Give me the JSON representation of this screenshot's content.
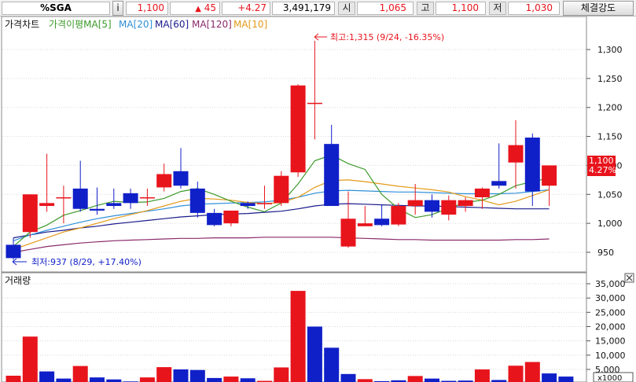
{
  "header": {
    "symbol": "%SGA",
    "info_label": "i",
    "price": "1,100",
    "change_arrow": "▲",
    "change": "45",
    "change_pct": "+4.27",
    "volume": "3,491,179",
    "open_label": "시",
    "open": "1,065",
    "high_label": "고",
    "high": "1,100",
    "low_label": "저",
    "low": "1,030",
    "strength_button": "체결강도"
  },
  "legend": {
    "title": "가격차트",
    "items": [
      {
        "label": "가격이평MA[5]",
        "color": "#3c9a2a"
      },
      {
        "label": "MA[20]",
        "color": "#2f8fd8"
      },
      {
        "label": "MA[60]",
        "color": "#1a1a8c"
      },
      {
        "label": "MA[120]",
        "color": "#8a2a6a"
      },
      {
        "label": "MA[10]",
        "color": "#e39a1a"
      }
    ]
  },
  "annotations": {
    "high": "최고:1,315 (9/24, -16.35%)",
    "low": "최저:937 (8/29, +17.40%)"
  },
  "price_axis": {
    "ticks": [
      "1,300",
      "1,250",
      "1,200",
      "1,150",
      "1,100",
      "1,050",
      "1,000",
      "950"
    ],
    "current_price": "1,100",
    "current_pct": "4.27%"
  },
  "volume_panel": {
    "title": "거래량",
    "ticks": [
      "35,000",
      "30,000",
      "25,000",
      "20,000",
      "15,000",
      "10,000",
      "5,000"
    ],
    "unit": "x1000",
    "close_icon": "close-icon"
  },
  "colors": {
    "up": "#e8141c",
    "down": "#1020c8",
    "ma5": "#3c9a2a",
    "ma20": "#2f8fd8",
    "ma60": "#1a1a8c",
    "ma120": "#8a2a6a",
    "ma10": "#e39a1a"
  },
  "chart_data": [
    {
      "type": "candlestick",
      "title": "가격차트",
      "ylim": [
        910,
        1345
      ],
      "candles": [
        {
          "open": 963,
          "high": 975,
          "low": 937,
          "close": 940
        },
        {
          "open": 985,
          "high": 1050,
          "low": 975,
          "close": 1050
        },
        {
          "open": 1030,
          "high": 1120,
          "low": 1020,
          "close": 1035
        },
        {
          "open": 1045,
          "high": 1065,
          "low": 1000,
          "close": 1045
        },
        {
          "open": 1060,
          "high": 1108,
          "low": 1020,
          "close": 1025
        },
        {
          "open": 1025,
          "high": 1062,
          "low": 1015,
          "close": 1022
        },
        {
          "open": 1035,
          "high": 1060,
          "low": 1025,
          "close": 1030
        },
        {
          "open": 1052,
          "high": 1060,
          "low": 1025,
          "close": 1035
        },
        {
          "open": 1045,
          "high": 1060,
          "low": 1030,
          "close": 1045
        },
        {
          "open": 1062,
          "high": 1103,
          "low": 1055,
          "close": 1085
        },
        {
          "open": 1090,
          "high": 1130,
          "low": 1060,
          "close": 1065
        },
        {
          "open": 1060,
          "high": 1072,
          "low": 1010,
          "close": 1018
        },
        {
          "open": 1018,
          "high": 1025,
          "low": 995,
          "close": 997
        },
        {
          "open": 1000,
          "high": 1020,
          "low": 995,
          "close": 1022
        },
        {
          "open": 1035,
          "high": 1038,
          "low": 1025,
          "close": 1030
        },
        {
          "open": 1035,
          "high": 1065,
          "low": 1025,
          "close": 1035
        },
        {
          "open": 1035,
          "high": 1090,
          "low": 1030,
          "close": 1082
        },
        {
          "open": 1088,
          "high": 1240,
          "low": 1080,
          "close": 1238
        },
        {
          "open": 1208,
          "high": 1315,
          "low": 1145,
          "close": 1208
        },
        {
          "open": 1137,
          "high": 1170,
          "low": 1030,
          "close": 1030
        },
        {
          "open": 960,
          "high": 1055,
          "low": 958,
          "close": 1008
        },
        {
          "open": 995,
          "high": 1030,
          "low": 995,
          "close": 1000
        },
        {
          "open": 1008,
          "high": 1032,
          "low": 995,
          "close": 997
        },
        {
          "open": 998,
          "high": 1035,
          "low": 995,
          "close": 1030
        },
        {
          "open": 1030,
          "high": 1068,
          "low": 1015,
          "close": 1040
        },
        {
          "open": 1040,
          "high": 1050,
          "low": 1010,
          "close": 1020
        },
        {
          "open": 1015,
          "high": 1048,
          "low": 1005,
          "close": 1040
        },
        {
          "open": 1030,
          "high": 1045,
          "low": 1020,
          "close": 1040
        },
        {
          "open": 1045,
          "high": 1062,
          "low": 1025,
          "close": 1060
        },
        {
          "open": 1073,
          "high": 1138,
          "low": 1060,
          "close": 1065
        },
        {
          "open": 1105,
          "high": 1178,
          "low": 1060,
          "close": 1135
        },
        {
          "open": 1148,
          "high": 1155,
          "low": 1030,
          "close": 1055
        },
        {
          "open": 1065,
          "high": 1100,
          "low": 1030,
          "close": 1100
        }
      ],
      "ma5": [
        960,
        985,
        997,
        1014,
        1022,
        1031,
        1038,
        1036,
        1037,
        1043,
        1055,
        1060,
        1050,
        1038,
        1028,
        1020,
        1035,
        1068,
        1108,
        1118,
        1103,
        1093,
        1050,
        1025,
        1010,
        1015,
        1026,
        1036,
        1040,
        1050,
        1065,
        1072,
        1078
      ],
      "ma10": [
        955,
        965,
        975,
        985,
        992,
        1000,
        1008,
        1015,
        1022,
        1030,
        1038,
        1043,
        1042,
        1040,
        1036,
        1034,
        1036,
        1045,
        1062,
        1074,
        1075,
        1072,
        1068,
        1064,
        1061,
        1058,
        1054,
        1046,
        1040,
        1032,
        1038,
        1048,
        1058
      ],
      "ma20": [
        970,
        980,
        988,
        995,
        1002,
        1008,
        1013,
        1017,
        1021,
        1025,
        1030,
        1033,
        1034,
        1035,
        1036,
        1037,
        1040,
        1045,
        1052,
        1056,
        1057,
        1056,
        1055,
        1054,
        1054,
        1053,
        1052,
        1051,
        1051,
        1051,
        1052,
        1055,
        1058
      ],
      "ma60": [
        975,
        980,
        985,
        988,
        992,
        995,
        999,
        1002,
        1005,
        1008,
        1011,
        1013,
        1015,
        1016,
        1017,
        1019,
        1021,
        1025,
        1030,
        1033,
        1034,
        1033,
        1032,
        1031,
        1030,
        1030,
        1029,
        1028,
        1027,
        1026,
        1025,
        1025,
        1025
      ],
      "ma120": [
        950,
        955,
        960,
        963,
        966,
        968,
        970,
        971,
        972,
        973,
        974,
        974,
        975,
        975,
        975,
        976,
        976,
        976,
        976,
        976,
        975,
        974,
        973,
        972,
        972,
        971,
        971,
        971,
        971,
        971,
        972,
        972,
        973
      ]
    },
    {
      "type": "bar",
      "title": "거래량",
      "unit": "x1000",
      "ylim": [
        0,
        39000
      ],
      "values": [
        2800,
        16500,
        4300,
        1800,
        6200,
        2200,
        1500,
        800,
        2200,
        5800,
        5000,
        4800,
        2000,
        2500,
        1900,
        1000,
        5700,
        32500,
        20000,
        12600,
        3400,
        1600,
        900,
        1200,
        2700,
        1800,
        1000,
        1100,
        5000,
        1300,
        6300,
        7600,
        3600,
        2500
      ],
      "up": [
        true,
        true,
        false,
        false,
        true,
        false,
        false,
        false,
        true,
        true,
        false,
        false,
        false,
        true,
        false,
        true,
        true,
        true,
        false,
        false,
        false,
        true,
        false,
        false,
        true,
        false,
        false,
        false,
        true,
        false,
        true,
        true,
        false,
        false
      ]
    }
  ]
}
